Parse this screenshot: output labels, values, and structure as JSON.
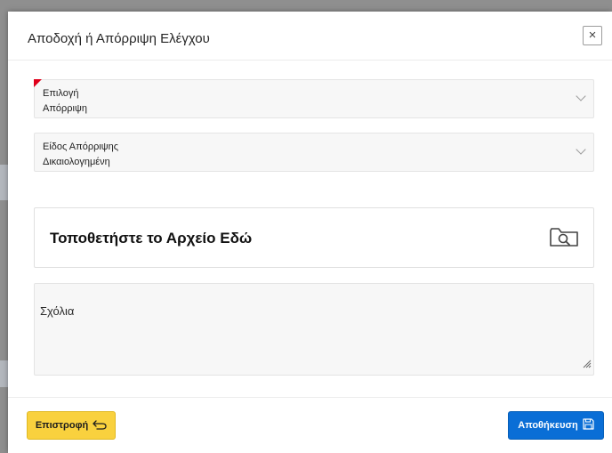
{
  "dialog": {
    "title": "Αποδοχή ή Απόρριψη Ελέγχου",
    "close_glyph": "×"
  },
  "fields": {
    "option": {
      "label": "Επιλογή",
      "value": "Απόρριψη",
      "required": true
    },
    "rejection_type": {
      "label": "Είδος Απόρριψης",
      "value": "Δικαιολογημένη"
    }
  },
  "dropzone": {
    "text": "Τοποθετήστε το Αρχείο Εδώ",
    "icon": "folder-search-icon"
  },
  "comments": {
    "placeholder": "Σχόλια",
    "value": ""
  },
  "footer": {
    "back_label": "Επιστροφή",
    "back_icon": "undo-arrow-icon",
    "save_label": "Αποθήκευση",
    "save_icon": "floppy-disk-icon"
  },
  "colors": {
    "required_marker": "#e0001b",
    "back_button": "#f9d13e",
    "save_button": "#0a6ed6"
  }
}
